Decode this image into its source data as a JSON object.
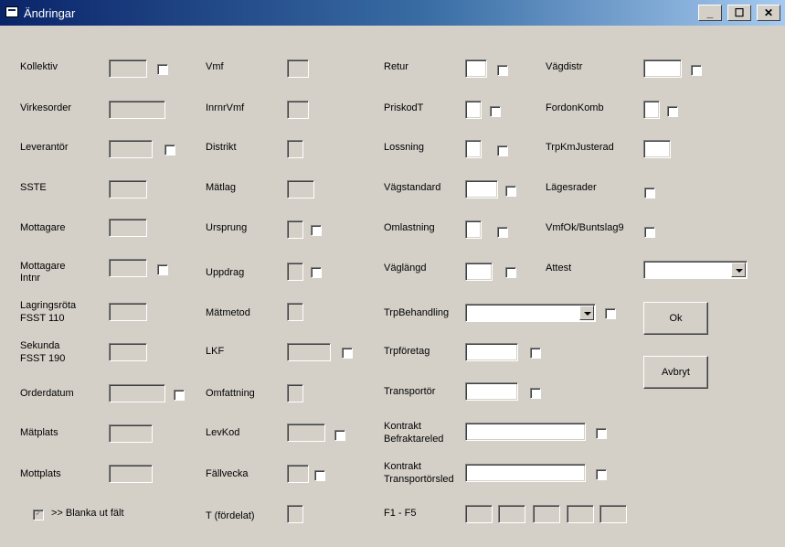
{
  "window": {
    "title": "Ändringar",
    "minimize": "_",
    "maximize": "☐",
    "close": "✕"
  },
  "labels": {
    "kollektiv": "Kollektiv",
    "virkesorder": "Virkesorder",
    "leverantor": "Leverantör",
    "sste": "SSTE",
    "mottagare": "Mottagare",
    "mottagare_intnr_1": "Mottagare",
    "mottagare_intnr_2": "Intnr",
    "lagringsrota_1": "Lagringsröta",
    "lagringsrota_2": "FSST 110",
    "sekunda_1": "Sekunda",
    "sekunda_2": "FSST 190",
    "orderdatum": "Orderdatum",
    "matplats": "Mätplats",
    "mottplats": "Mottplats",
    "blanka": ">> Blanka ut fält",
    "vmf": "Vmf",
    "inrnrvmf": "InrnrVmf",
    "distrikt": "Distrikt",
    "matlag": "Mätlag",
    "ursprung": "Ursprung",
    "uppdrag": "Uppdrag",
    "matmetod": "Mätmetod",
    "lkf": "LKF",
    "omfattning": "Omfattning",
    "levkod": "LevKod",
    "fallvecka": "Fällvecka",
    "t_fordelat": "T (fördelat)",
    "retur": "Retur",
    "priskodt": "PriskodT",
    "lossning": "Lossning",
    "vagstandard": "Vägstandard",
    "omlastning": "Omlastning",
    "vaglangd": "Väglängd",
    "trpbehandling": "TrpBehandling",
    "trpforetag": "Trpföretag",
    "transportor": "Transportör",
    "kontrakt_bef_1": "Kontrakt",
    "kontrakt_bef_2": "Befraktareled",
    "kontrakt_tr_1": "Kontrakt",
    "kontrakt_tr_2": "Transportörsled",
    "f1f5": "F1 - F5",
    "vagdistr": "Vägdistr",
    "fordonkomb": "FordonKomb",
    "trpkmjusterad": "TrpKmJusterad",
    "lagesrader": "Lägesrader",
    "vmfok": "VmfOk/Buntslag9",
    "attest": "Attest"
  },
  "buttons": {
    "ok": "Ok",
    "avbryt": "Avbryt"
  },
  "checkboxes": {
    "blanka_checked_mark": "✓"
  }
}
